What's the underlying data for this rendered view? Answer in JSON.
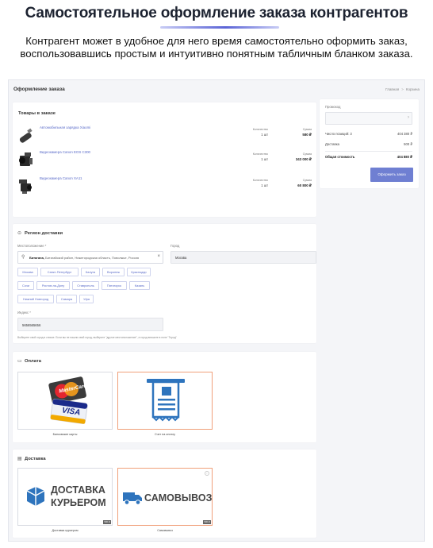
{
  "hero": {
    "title": "Самостоятельное оформление заказа контрагентов",
    "desc_line1": "Контрагент может в удобное для него время самостоятельно оформить заказ,",
    "desc_line2": "воспользовавшись простым и интуитивно понятным табличным бланком заказа."
  },
  "app": {
    "page_title": "Оформление заказа",
    "breadcrumb": [
      "Главная",
      "Корзина"
    ],
    "goods": {
      "title": "Товары в заказе",
      "qty_label": "Количество",
      "sum_label": "Сумма",
      "items": [
        {
          "name": "Автомобильная зарядка Xiaomi",
          "qty": "1 шт",
          "sum": "580 ₽"
        },
        {
          "name": "Видеокамера Canon EOS C300",
          "qty": "1 шт",
          "sum": "343 000 ₽"
        },
        {
          "name": "Видеокамера Canon XA11",
          "qty": "1 шт",
          "sum": "60 800 ₽"
        }
      ]
    },
    "summary": {
      "promo_label": "Промокод",
      "promo_arrow": "›",
      "positions_label": "Число позиций: 3",
      "positions_value": "404 380 ₽",
      "delivery_label": "Доставка",
      "delivery_value": "500 ₽",
      "total_label": "Общая стоимость",
      "total_value": "404 880 ₽",
      "order_button": "Оформить заказ"
    },
    "region": {
      "title": "Регион доставки",
      "location_label": "Местоположение *",
      "location_bold": "Батагана,",
      "location_rest": " Батагайский район, Нижегородская область, Поволжье, Россия",
      "city_label": "Город",
      "city_value": "Москва",
      "chips": [
        "Москва",
        "Санкт-Петербург",
        "Калуга",
        "Воронеж",
        "Краснодар",
        "Сочи",
        "Ростов-на-Дону",
        "Ставрополь",
        "Пятигорск",
        "Казань",
        "Нижний Новгород",
        "Самара",
        "Уфа"
      ],
      "index_label": "Индекс *",
      "index_value": "5656565656",
      "hint": "Выберите свой город в списке. Если вы не нашли свой город, выберите \"другое местоположение\", а город впишите в поле \"Город\""
    },
    "payment": {
      "title": "Оплата",
      "options": [
        {
          "caption": "Банковские карты",
          "logo1": "MasterCard",
          "logo2": "VISA"
        },
        {
          "caption": "Счет на оплату"
        }
      ]
    },
    "delivery": {
      "title": "Доставка",
      "options": [
        {
          "caption": "Доставка курьером",
          "text1": "ДОСТАВКА",
          "text2": "КУРЬЕРОМ",
          "badge": "500 ₽"
        },
        {
          "caption": "Самовывоз",
          "text1": "САМОВЫВОЗ",
          "badge": "500 ₽"
        }
      ]
    },
    "colors": {
      "accent": "#6f7fd2",
      "link": "#5a6bc9",
      "selected_border": "#f0a07a",
      "icon_blue": "#2e74bd"
    }
  }
}
